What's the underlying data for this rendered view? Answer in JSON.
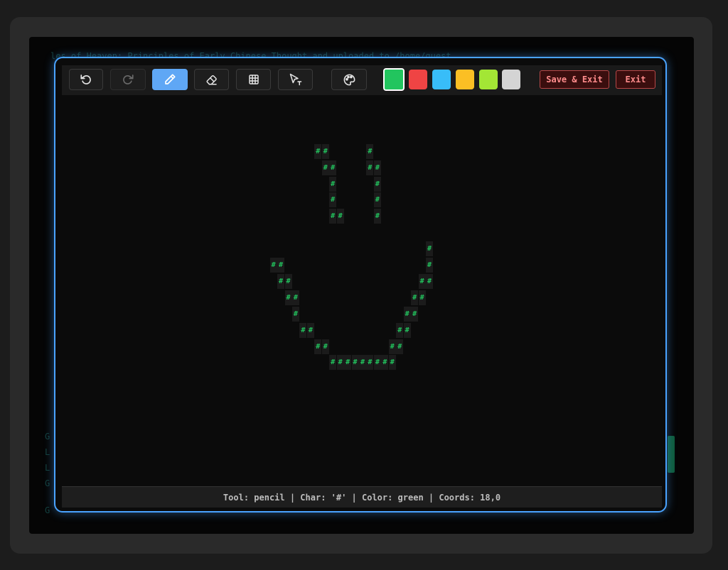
{
  "background_terminal": {
    "top_line": "les of Heaven: Principles of Early Chinese Thought and  uploaded to  /home/guest",
    "left_chars": [
      "G",
      "L",
      "L",
      "G",
      "G"
    ]
  },
  "toolbar": {
    "undo_icon": "undo-icon",
    "redo_icon": "redo-icon",
    "pencil_icon": "pencil-icon",
    "eraser_icon": "eraser-icon",
    "grid_icon": "grid-icon",
    "select_icon": "cursor-select-icon",
    "palette_icon": "palette-icon",
    "active_tool": "pencil",
    "colors": [
      {
        "name": "green",
        "hex": "#22c55e",
        "selected": true
      },
      {
        "name": "red",
        "hex": "#ef4444",
        "selected": false
      },
      {
        "name": "blue",
        "hex": "#38bdf8",
        "selected": false
      },
      {
        "name": "yellow",
        "hex": "#fbbf24",
        "selected": false
      },
      {
        "name": "lime",
        "hex": "#a3e635",
        "selected": false
      },
      {
        "name": "white",
        "hex": "#d4d4d4",
        "selected": false
      }
    ],
    "save_exit_label": "Save & Exit",
    "exit_label": "Exit"
  },
  "canvas": {
    "char": "#",
    "color": "#22c55e",
    "cells": [
      [
        34,
        3
      ],
      [
        35,
        3
      ],
      [
        41,
        3
      ],
      [
        35,
        4
      ],
      [
        36,
        4
      ],
      [
        41,
        4
      ],
      [
        42,
        4
      ],
      [
        36,
        5
      ],
      [
        42,
        5
      ],
      [
        36,
        6
      ],
      [
        42,
        6
      ],
      [
        36,
        7
      ],
      [
        37,
        7
      ],
      [
        42,
        7
      ],
      [
        49,
        9
      ],
      [
        28,
        10
      ],
      [
        29,
        10
      ],
      [
        49,
        10
      ],
      [
        29,
        11
      ],
      [
        30,
        11
      ],
      [
        48,
        11
      ],
      [
        49,
        11
      ],
      [
        30,
        12
      ],
      [
        31,
        12
      ],
      [
        47,
        12
      ],
      [
        48,
        12
      ],
      [
        31,
        13
      ],
      [
        46,
        13
      ],
      [
        47,
        13
      ],
      [
        32,
        14
      ],
      [
        33,
        14
      ],
      [
        45,
        14
      ],
      [
        46,
        14
      ],
      [
        34,
        15
      ],
      [
        35,
        15
      ],
      [
        44,
        15
      ],
      [
        45,
        15
      ],
      [
        36,
        16
      ],
      [
        37,
        16
      ],
      [
        38,
        16
      ],
      [
        39,
        16
      ],
      [
        40,
        16
      ],
      [
        41,
        16
      ],
      [
        42,
        16
      ],
      [
        43,
        16
      ],
      [
        44,
        16
      ]
    ]
  },
  "status": {
    "text": "Tool: pencil | Char: '#' | Color: green | Coords: 18,0"
  }
}
